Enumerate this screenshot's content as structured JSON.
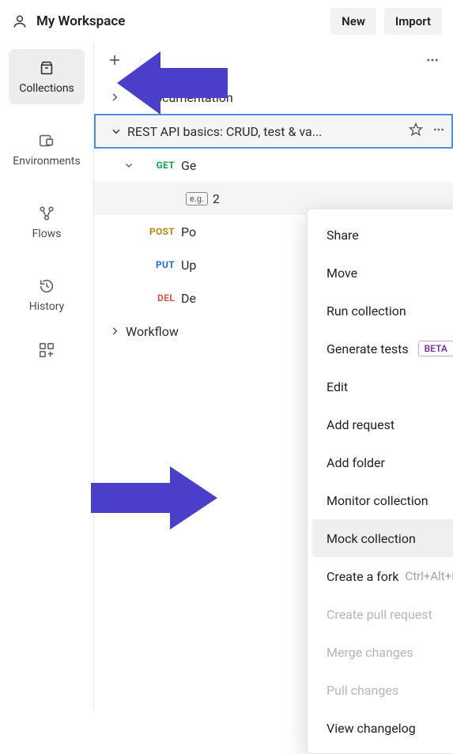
{
  "header": {
    "workspace": "My Workspace",
    "new_btn": "New",
    "import_btn": "Import"
  },
  "sidebar": {
    "items": [
      {
        "label": "Collections",
        "icon": "box-icon",
        "active": true
      },
      {
        "label": "Environments",
        "icon": "env-icon",
        "active": false
      },
      {
        "label": "Flows",
        "icon": "flows-icon",
        "active": false
      },
      {
        "label": "History",
        "icon": "history-icon",
        "active": false
      }
    ]
  },
  "tree": {
    "collection1": {
      "label": "documentation"
    },
    "collection2": {
      "label": "REST API basics: CRUD, test & va..."
    },
    "requests": [
      {
        "method": "GET",
        "label": "Ge",
        "expanded": true,
        "method_class": "m-get"
      },
      {
        "method": "",
        "label": "2",
        "is_example": true
      },
      {
        "method": "POST",
        "label": "Po",
        "method_class": "m-post"
      },
      {
        "method": "PUT",
        "label": "Up",
        "method_class": "m-put"
      },
      {
        "method": "DEL",
        "label": "De",
        "method_class": "m-del"
      }
    ],
    "collection3": {
      "label": "Workflow"
    }
  },
  "menu": {
    "items": [
      {
        "label": "Share"
      },
      {
        "label": "Move"
      },
      {
        "label": "Run collection"
      },
      {
        "label": "Generate tests",
        "badge": "BETA"
      },
      {
        "label": "Edit"
      },
      {
        "label": "Add request"
      },
      {
        "label": "Add folder"
      },
      {
        "label": "Monitor collection"
      },
      {
        "label": "Mock collection",
        "highlight": true
      },
      {
        "label": "Create a fork",
        "shortcut": "Ctrl+Alt+F"
      },
      {
        "label": "Create pull request",
        "disabled": true
      },
      {
        "label": "Merge changes",
        "disabled": true
      },
      {
        "label": "Pull changes",
        "disabled": true
      },
      {
        "label": "View changelog"
      }
    ]
  }
}
